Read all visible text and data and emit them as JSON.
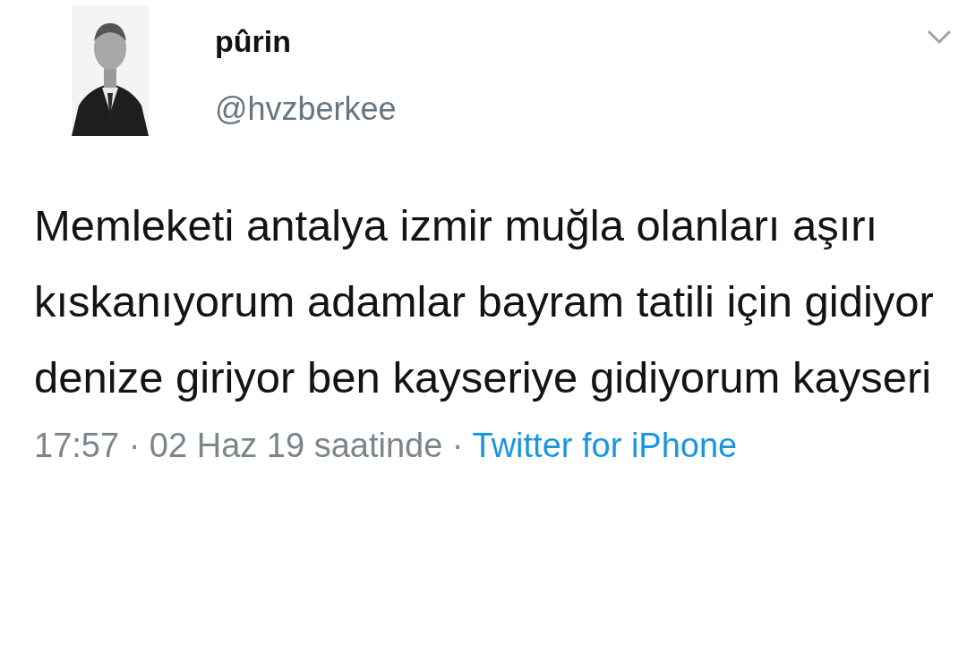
{
  "tweet": {
    "name": "pûrin",
    "handle": "@hvzberkee",
    "text": "Memleketi antalya izmir muğla olanları aşırı kıskanıyorum adamlar bayram tatili için gidiyor denize giriyor ben kayseriye gidiyorum kayseri",
    "time": "17:57 · 02 Haz 19 saatinde ·",
    "source": "Twitter for iPhone"
  }
}
